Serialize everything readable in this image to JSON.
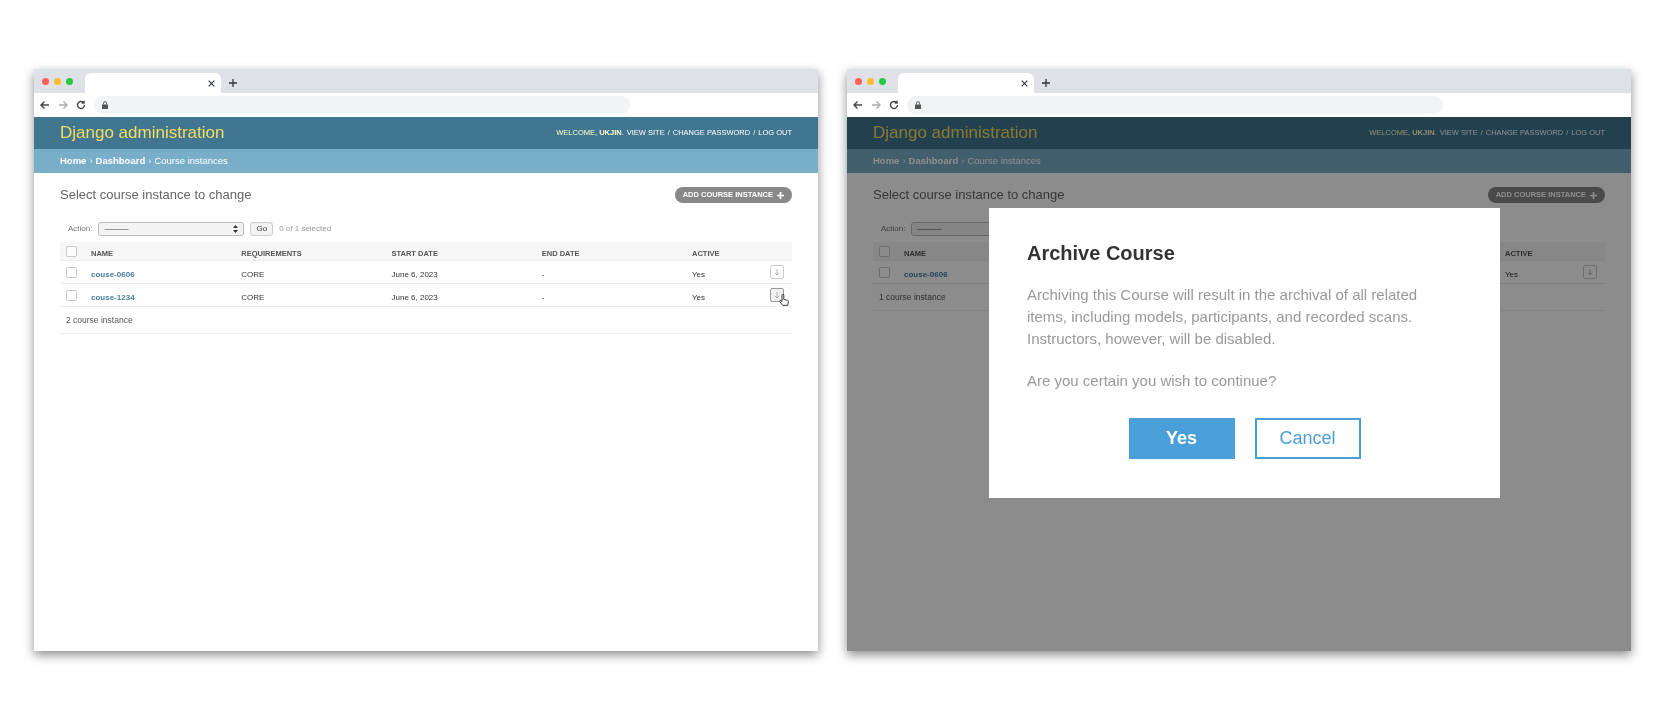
{
  "windows": [
    {
      "header": {
        "title": "Django administration",
        "user_tools": [
          {
            "kind": "text",
            "text": "WELCOME, **UKJIN**."
          },
          {
            "kind": "link",
            "text": "VIEW SITE"
          },
          {
            "kind": "text",
            "text": "/"
          },
          {
            "kind": "link",
            "text": "CHANGE PASSWORD"
          },
          {
            "kind": "text",
            "text": "/"
          },
          {
            "kind": "link",
            "text": "LOG OUT"
          }
        ]
      },
      "breadcrumbs": [
        {
          "kind": "link",
          "text": "Home"
        },
        {
          "kind": "separator",
          "text": "›"
        },
        {
          "kind": "link",
          "text": "Dashboard"
        },
        {
          "kind": "separator",
          "text": "›"
        },
        {
          "kind": "current",
          "text": "Course instances"
        }
      ],
      "page_title": "Select course instance to change",
      "add_button": "ADD COURSE INSTANCE",
      "actions": {
        "label": "Action:",
        "value": "———",
        "go": "Go",
        "count": "0 of 1 selected"
      },
      "table": {
        "header_checked": false,
        "columns": [
          "NAME",
          "REQUIREMENTS",
          "START DATE",
          "END DATE",
          "ACTIVE"
        ],
        "rows": [
          {
            "checked": false,
            "cells": [
              "couse-0606",
              "CORE",
              "June 6, 2023",
              "-",
              "Yes"
            ],
            "hovered": false
          },
          {
            "checked": false,
            "cells": [
              "couse-1234",
              "CORE",
              "June 6, 2023",
              "-",
              "Yes"
            ],
            "hovered": true
          }
        ]
      },
      "footer": "2 course instance"
    },
    {
      "header": {
        "title": "Django administration",
        "user_tools": [
          {
            "kind": "text",
            "text": "WELCOME, **UKJIN**."
          },
          {
            "kind": "link",
            "text": "VIEW SITE"
          },
          {
            "kind": "text",
            "text": "/"
          },
          {
            "kind": "link",
            "text": "CHANGE PASSWORD"
          },
          {
            "kind": "text",
            "text": "/"
          },
          {
            "kind": "link",
            "text": "LOG OUT"
          }
        ]
      },
      "breadcrumbs": [
        {
          "kind": "link",
          "text": "Home"
        },
        {
          "kind": "separator",
          "text": "›"
        },
        {
          "kind": "link",
          "text": "Dashboard"
        },
        {
          "kind": "separator",
          "text": "›"
        },
        {
          "kind": "current",
          "text": "Course instances"
        }
      ],
      "page_title": "Select course instance to change",
      "add_button": "ADD COURSE INSTANCE",
      "actions": {
        "label": "Action:",
        "value": "———"
      },
      "table": {
        "header_checked": false,
        "columns": [
          "NAME",
          "ACTIVE"
        ],
        "rows": [
          {
            "checked": false,
            "cells": [
              "couse-0606",
              "Yes"
            ],
            "hovered": false
          }
        ]
      },
      "footer": "1 course instance",
      "dialog": {
        "title": "Archive Course",
        "paragraphs": [
          "Archiving this Course will result in the archival of all related items, including models, participants, and recorded scans. Instructors, however, will be disabled.",
          "Are you certain you wish to continue?"
        ],
        "buttons": [
          {
            "kind": "primary",
            "label": "Yes"
          },
          {
            "kind": "secondary",
            "label": "Cancel"
          }
        ]
      }
    }
  ]
}
